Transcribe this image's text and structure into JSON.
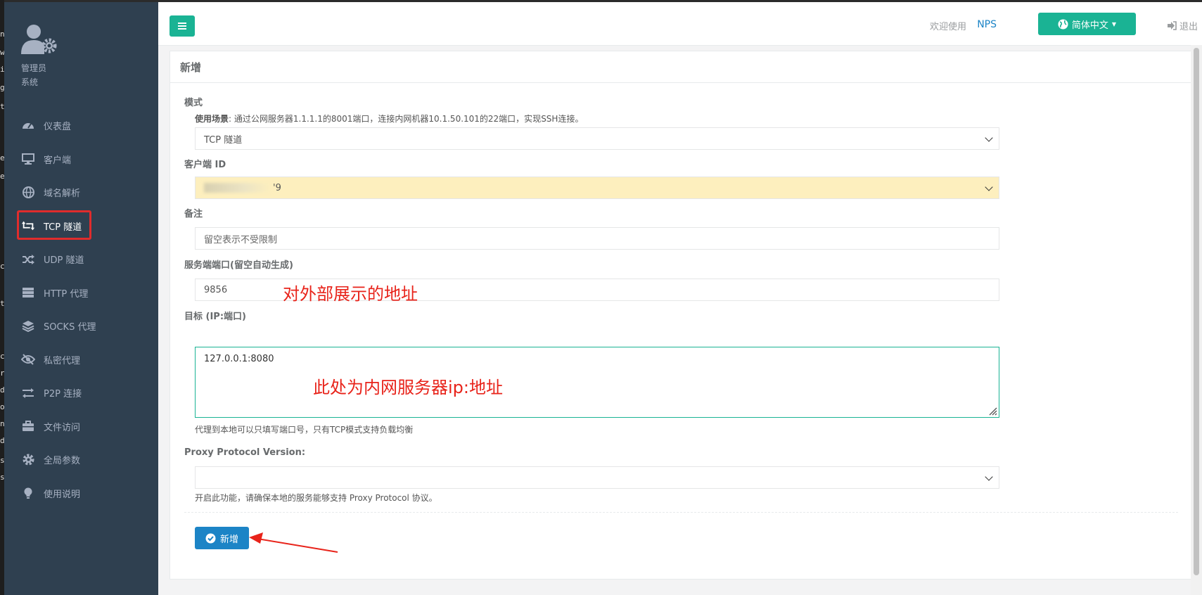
{
  "sidebar": {
    "profile": {
      "line1": "管理员",
      "line2": "系统"
    },
    "items": [
      {
        "label": "仪表盘",
        "icon": "dashboard-icon"
      },
      {
        "label": "客户端",
        "icon": "monitor-icon"
      },
      {
        "label": "域名解析",
        "icon": "globe-icon"
      },
      {
        "label": "TCP 隧道",
        "icon": "retweet-icon"
      },
      {
        "label": "UDP 隧道",
        "icon": "random-icon"
      },
      {
        "label": "HTTP 代理",
        "icon": "server-icon"
      },
      {
        "label": "SOCKS 代理",
        "icon": "layers-icon"
      },
      {
        "label": "私密代理",
        "icon": "eye-slash-icon"
      },
      {
        "label": "P2P 连接",
        "icon": "exchange-icon"
      },
      {
        "label": "文件访问",
        "icon": "briefcase-icon"
      },
      {
        "label": "全局参数",
        "icon": "gear-icon"
      },
      {
        "label": "使用说明",
        "icon": "lightbulb-icon"
      }
    ]
  },
  "header": {
    "welcome": "欢迎使用",
    "brand": "NPS",
    "language": "简体中文",
    "logout": "退出"
  },
  "panel": {
    "title": "新增",
    "mode": {
      "label": "模式",
      "scenario_label": "使用场景",
      "scenario_text": ": 通过公网服务器1.1.1.1的8001端口，连接内网机器10.1.50.101的22端口，实现SSH连接。",
      "value": "TCP 隧道"
    },
    "client": {
      "label": "客户端 ID",
      "value_suffix": "'9"
    },
    "remark": {
      "label": "备注",
      "placeholder": "留空表示不受限制"
    },
    "port": {
      "label": "服务端端口(留空自动生成)",
      "value": "9856"
    },
    "target": {
      "label": "目标 (IP:端口)",
      "value": "127.0.0.1:8080",
      "help": "代理到本地可以只填写端口号，只有TCP模式支持负载均衡"
    },
    "proxy_protocol": {
      "label": "Proxy Protocol Version:",
      "value": "",
      "help": "开启此功能，请确保本地的服务能够支持 Proxy Protocol 协议。"
    },
    "submit_label": "新增"
  },
  "annotations": {
    "port_note": "对外部展示的地址",
    "target_note": "此处为内网服务器ip:地址",
    "color": "#e8231a"
  },
  "edge_chars": [
    "n",
    "w",
    "i",
    "g",
    "t",
    "e",
    "e",
    "c",
    "t",
    "c",
    "r",
    "d",
    "o",
    "n",
    "d",
    "s",
    "s"
  ]
}
